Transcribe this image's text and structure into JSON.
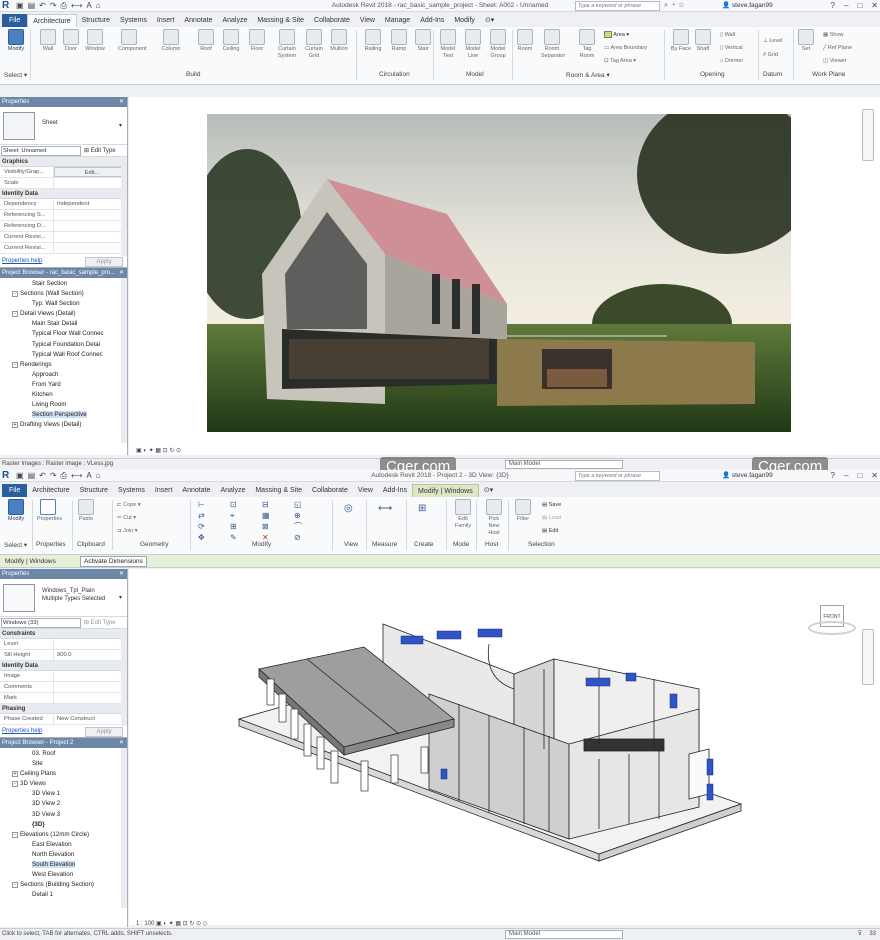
{
  "w1": {
    "title": "Autodesk Revit 2018 -   rac_basic_sample_project - Sheet: A002 - Unnamed",
    "search_placeholder": "Type a keyword or phrase",
    "user": "steve.fagan99",
    "tabs": [
      "File",
      "Architecture",
      "Structure",
      "Systems",
      "Insert",
      "Annotate",
      "Analyze",
      "Massing & Site",
      "Collaborate",
      "View",
      "Manage",
      "Add-Ins",
      "Modify"
    ],
    "active_tab": "Architecture",
    "ribbon": {
      "buttons": [
        "Modify",
        "Wall",
        "Door",
        "Window",
        "Component",
        "Column",
        "Roof",
        "Ceiling",
        "Floor",
        "Curtain System",
        "Curtain Grid",
        "Mullion",
        "Railing",
        "Ramp",
        "Stair",
        "Model Text",
        "Model Line",
        "Model Group",
        "Room",
        "Room Separator",
        "Tag Room",
        "By Face",
        "Shaft",
        "Set"
      ],
      "small": [
        "Area",
        "Area Boundary",
        "Tag Area",
        "Wall",
        "Vertical",
        "Dormer",
        "Level",
        "Grid",
        "Show",
        "Ref Plane",
        "Viewer"
      ],
      "panels": [
        "Select",
        "Build",
        "Circulation",
        "Model",
        "Room & Area",
        "Opening",
        "Datum",
        "Work Plane"
      ]
    },
    "properties": {
      "header": "Properties",
      "type_name": "Sheet",
      "instance": "Sheet: Unnamed",
      "edit_type": "Edit Type",
      "rows": [
        {
          "cat": "Graphics"
        },
        {
          "k": "Visibility/Grap...",
          "v": "Edit..."
        },
        {
          "k": "Scale",
          "v": ""
        },
        {
          "cat": "Identity Data"
        },
        {
          "k": "Dependency",
          "v": "Independent"
        },
        {
          "k": "Referencing S...",
          "v": ""
        },
        {
          "k": "Referencing D...",
          "v": ""
        },
        {
          "k": "Current Revisi...",
          "v": ""
        },
        {
          "k": "Current Revisi...",
          "v": ""
        }
      ],
      "help": "Properties help",
      "apply": "Apply"
    },
    "browser": {
      "header": "Project Browser - rac_basic_sample_pro...",
      "items": [
        {
          "l": "Stair Section",
          "d": 3
        },
        {
          "l": "Sections (Wall Section)",
          "d": 1,
          "t": "-"
        },
        {
          "l": "Typ. Wall Section",
          "d": 3
        },
        {
          "l": "Detail Views (Detail)",
          "d": 1,
          "t": "-"
        },
        {
          "l": "Main Stair Detail",
          "d": 3
        },
        {
          "l": "Typical Floor Wall Connec",
          "d": 3
        },
        {
          "l": "Typical Foundation Detai",
          "d": 3
        },
        {
          "l": "Typical Wall Roof Connec",
          "d": 3
        },
        {
          "l": "Renderings",
          "d": 1,
          "t": "-"
        },
        {
          "l": "Approach",
          "d": 3
        },
        {
          "l": "From Yard",
          "d": 3
        },
        {
          "l": "Kitchen",
          "d": 3
        },
        {
          "l": "Living Room",
          "d": 3
        },
        {
          "l": "Section Perspective",
          "d": 3,
          "sel": true
        },
        {
          "l": "Drafting Views (Detail)",
          "d": 1,
          "t": "+"
        }
      ]
    },
    "status": "Raster Images : Raster image : VLess.jpg",
    "main_model": "Main Model"
  },
  "w2": {
    "title": "Autodesk Revit 2018 -   Project 2 - 3D View: {3D}",
    "search_placeholder": "Type a keyword or phrase",
    "user": "steve.fagan99",
    "tabs": [
      "File",
      "Architecture",
      "Structure",
      "Systems",
      "Insert",
      "Annotate",
      "Analyze",
      "Massing & Site",
      "Collaborate",
      "View",
      "Add-Ins",
      "Modify | Windows"
    ],
    "active_tab": "Modify | Windows",
    "ribbon": {
      "buttons": [
        "Modify",
        "Properties",
        "Paste",
        "Edit Family",
        "Pick New Host",
        "Filter"
      ],
      "small": [
        "Cope",
        "Cut",
        "Join",
        "Save",
        "Load",
        "Edit"
      ],
      "panels": [
        "Select",
        "Properties",
        "Clipboard",
        "Geometry",
        "Modify",
        "View",
        "Measure",
        "Create",
        "Mode",
        "Host",
        "Selection"
      ]
    },
    "contextbar": {
      "label": "Modify | Windows",
      "activate": "Activate Dimensions"
    },
    "properties": {
      "header": "Properties",
      "type_name": "Windows_Tpl_Plain\nMultiple Types Selected",
      "instance": "Windows (33)",
      "edit_type": "Edit Type",
      "rows": [
        {
          "cat": "Constraints"
        },
        {
          "k": "Level",
          "v": ""
        },
        {
          "k": "Sill Height",
          "v": "900.0"
        },
        {
          "cat": "Identity Data"
        },
        {
          "k": "Image",
          "v": ""
        },
        {
          "k": "Comments",
          "v": ""
        },
        {
          "k": "Mark",
          "v": ""
        },
        {
          "cat": "Phasing"
        },
        {
          "k": "Phase Created",
          "v": "New Construct"
        }
      ],
      "help": "Properties help",
      "apply": "Apply"
    },
    "browser": {
      "header": "Project Browser - Project 2",
      "items": [
        {
          "l": "03. Roof",
          "d": 3
        },
        {
          "l": "Site",
          "d": 3
        },
        {
          "l": "Ceiling Plans",
          "d": 1,
          "t": "+"
        },
        {
          "l": "3D Views",
          "d": 1,
          "t": "-"
        },
        {
          "l": "3D View 1",
          "d": 3
        },
        {
          "l": "3D View 2",
          "d": 3
        },
        {
          "l": "3D View 3",
          "d": 3
        },
        {
          "l": "{3D}",
          "d": 3,
          "b": true
        },
        {
          "l": "Elevations (12mm Circle)",
          "d": 1,
          "t": "-"
        },
        {
          "l": "East Elevation",
          "d": 3
        },
        {
          "l": "North Elevation",
          "d": 3
        },
        {
          "l": "South Elevation",
          "d": 3,
          "sel": true
        },
        {
          "l": "West Elevation",
          "d": 3
        },
        {
          "l": "Sections (Building Section)",
          "d": 1,
          "t": "-"
        },
        {
          "l": "Detail 1",
          "d": 3
        }
      ]
    },
    "scale": "1 : 100",
    "status": "Click to select, TAB for alternates, CTRL adds, SHIFT unselects.",
    "main_model": "Main Model",
    "viewcube": "FRONT",
    "sel_count": "33"
  },
  "watermark": "Cger.com"
}
